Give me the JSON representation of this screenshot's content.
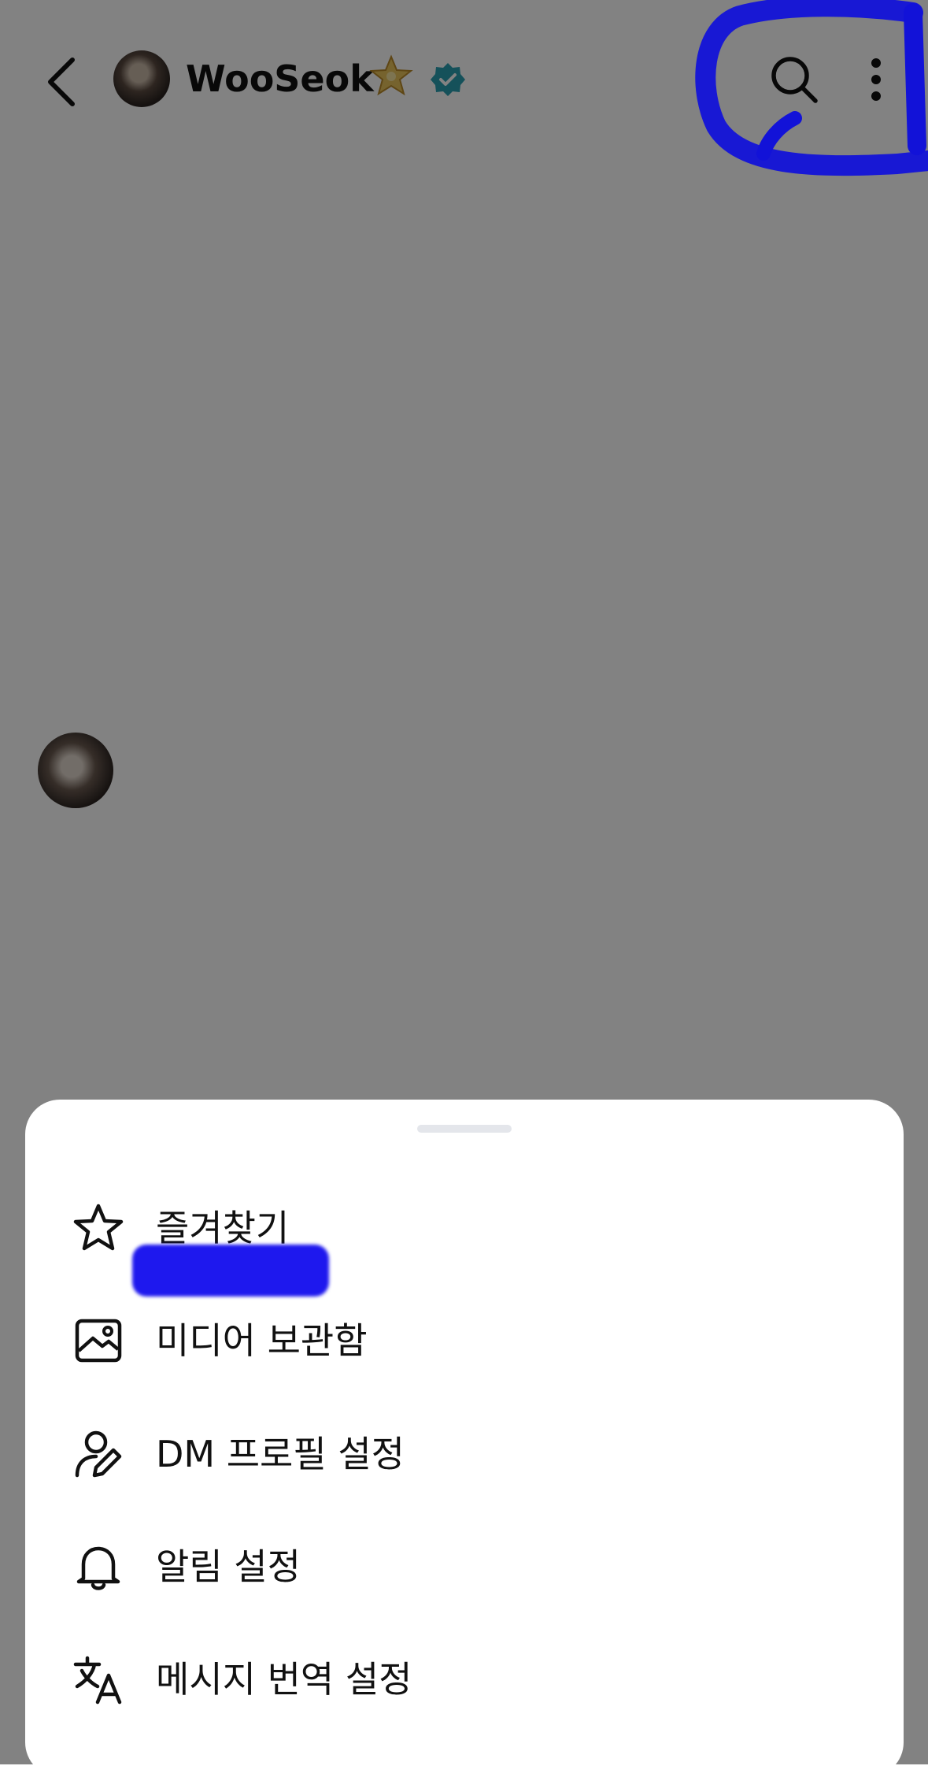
{
  "header": {
    "back_icon": "chevron-left-icon",
    "username": "WooSeok",
    "badges": [
      "star-badge-icon",
      "verified-badge-icon"
    ],
    "actions": [
      "search-icon",
      "more-vertical-icon"
    ]
  },
  "sheet": {
    "items": [
      {
        "label": "즐겨찾기",
        "icon": "star-outline-icon"
      },
      {
        "label": "미디어 보관함",
        "icon": "image-icon"
      },
      {
        "label": "DM 프로필 설정",
        "icon": "person-edit-icon"
      },
      {
        "label": "알림 설정",
        "icon": "bell-icon"
      },
      {
        "label": "메시지 번역 설정",
        "icon": "translate-icon"
      }
    ]
  },
  "colors": {
    "overlay": "#000000",
    "verified": "#2aa0b0",
    "annotation": "#1212d8",
    "redaction": "#1e18ee"
  }
}
